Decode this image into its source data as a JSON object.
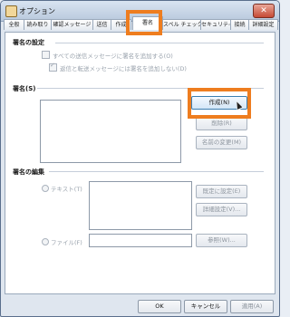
{
  "window": {
    "title": "オプション",
    "close_label": "✕"
  },
  "tabs": [
    "全般",
    "読み取り",
    "確認メッセージ",
    "送信",
    "作成",
    "署名",
    "スペル チェック",
    "セキュリティ",
    "接続",
    "詳細設定"
  ],
  "signature_settings": {
    "heading": "署名の設定",
    "add_to_all": "すべての送信メッセージに署名を追加する(O)",
    "no_sig_on_reply": "返信と転送メッセージには署名を追加しない(D)"
  },
  "signatures": {
    "heading": "署名(S)",
    "create": "作成(N)",
    "delete": "削除(R)",
    "rename": "名前の変更(M)"
  },
  "edit_signature": {
    "heading": "署名の編集",
    "text_option": "テキスト(T)",
    "file_option": "ファイル(F)",
    "set_default": "既定に設定(E)",
    "advanced": "詳細設定(V)...",
    "browse": "参照(W)..."
  },
  "footer": {
    "ok": "OK",
    "cancel": "キャンセル",
    "apply": "適用(A)"
  },
  "colors": {
    "highlight": "#ee7d1f"
  }
}
